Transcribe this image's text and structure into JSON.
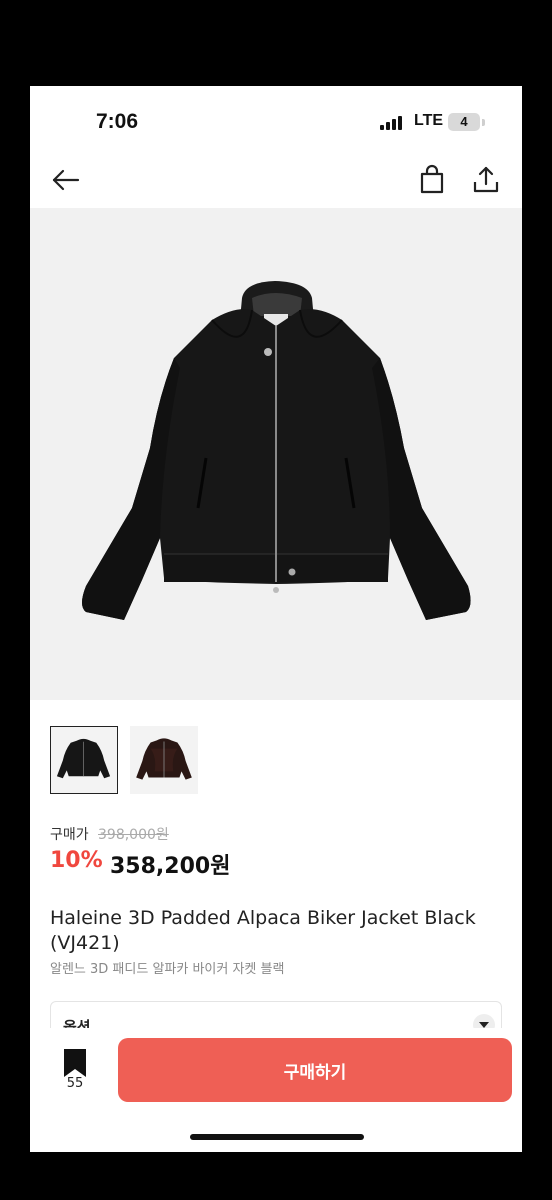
{
  "status_bar": {
    "time": "7:06",
    "network": "LTE",
    "battery": "4"
  },
  "nav": {
    "back_icon": "arrow-left-icon",
    "bag_icon": "shopping-bag-icon",
    "share_icon": "share-icon"
  },
  "product": {
    "original_label": "구매가",
    "original_price": "398,000원",
    "discount": "10%",
    "price": "358,200원",
    "title": "Haleine 3D Padded Alpaca Biker Jacket Black (VJ421)",
    "subtitle": "알렌느 3D 패디드 알파카 바이커 자켓 블랙"
  },
  "option": {
    "label": "옵션"
  },
  "bottom_bar": {
    "bookmark_count": "55",
    "buy_label": "구매하기"
  },
  "colors": {
    "accent": "#ef5f55",
    "discount": "#f0473e"
  }
}
